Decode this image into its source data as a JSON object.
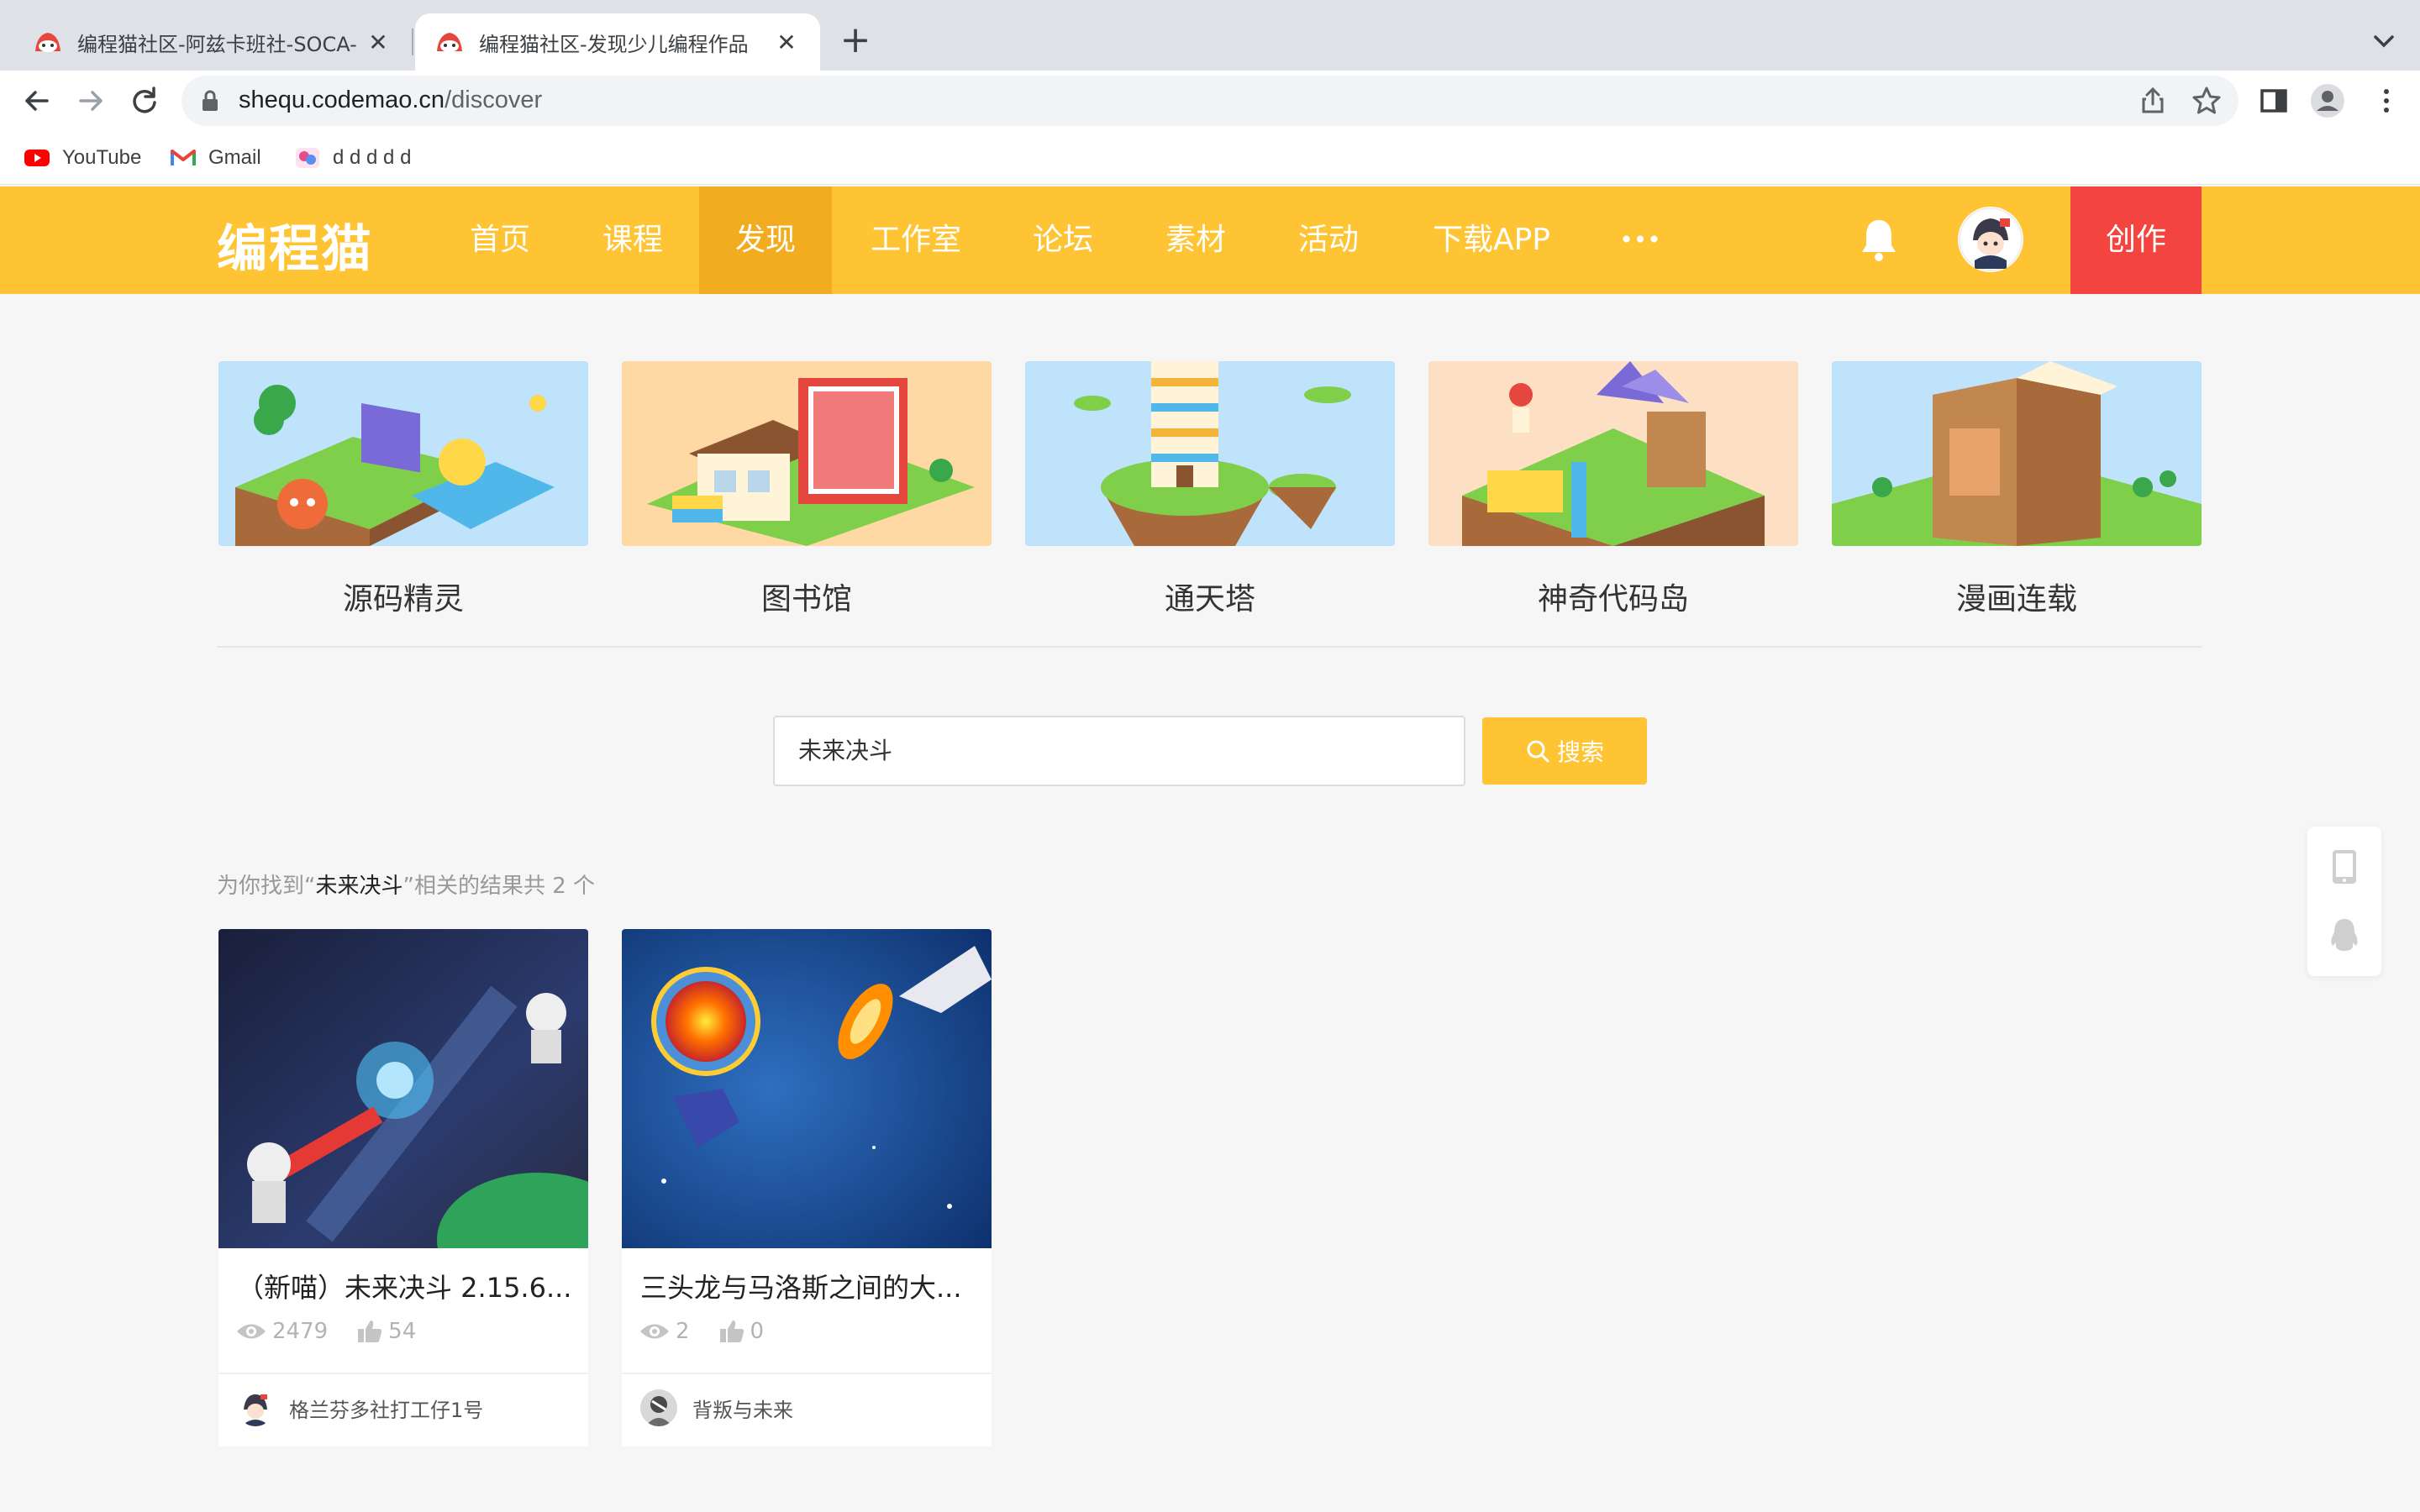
{
  "browser": {
    "tabs": [
      {
        "title": "编程猫社区-阿兹卡班社-SOCA-",
        "active": false
      },
      {
        "title": "编程猫社区-发现少儿编程作品",
        "active": true
      }
    ],
    "close_glyph": "✕",
    "new_tab_glyph": "+",
    "url_host": "shequ.codemao.cn",
    "url_path": "/discover",
    "bookmarks": [
      {
        "label": "YouTube",
        "icon": "youtube-icon"
      },
      {
        "label": "Gmail",
        "icon": "gmail-icon"
      },
      {
        "label": "d d d d d",
        "icon": "app-icon"
      }
    ]
  },
  "site": {
    "logo": "编程猫",
    "nav": [
      {
        "label": "首页",
        "active": false
      },
      {
        "label": "课程",
        "active": false
      },
      {
        "label": "发现",
        "active": true
      },
      {
        "label": "工作室",
        "active": false
      },
      {
        "label": "论坛",
        "active": false
      },
      {
        "label": "素材",
        "active": false
      },
      {
        "label": "活动",
        "active": false
      },
      {
        "label": "下载APP",
        "active": false
      },
      {
        "label": "•••",
        "active": false
      }
    ],
    "create_label": "创作",
    "colors": {
      "brand": "#fec433",
      "nav_active": "#f2ac1f",
      "create": "#f4443f"
    }
  },
  "features": [
    {
      "label": "源码精灵"
    },
    {
      "label": "图书馆"
    },
    {
      "label": "通天塔"
    },
    {
      "label": "神奇代码岛"
    },
    {
      "label": "漫画连载"
    }
  ],
  "search": {
    "value": "未来决斗",
    "button_label": "搜索",
    "result_prefix": "为你找到“",
    "result_keyword": "未来决斗",
    "result_suffix": "”相关的结果共 2 个"
  },
  "results": [
    {
      "title": "（新喵）未来决斗 2.15.6...",
      "views": "2479",
      "likes": "54",
      "author": "格兰芬多社打工仔1号"
    },
    {
      "title": "三头龙与马洛斯之间的大...",
      "views": "2",
      "likes": "0",
      "author": "背叛与未来"
    }
  ]
}
